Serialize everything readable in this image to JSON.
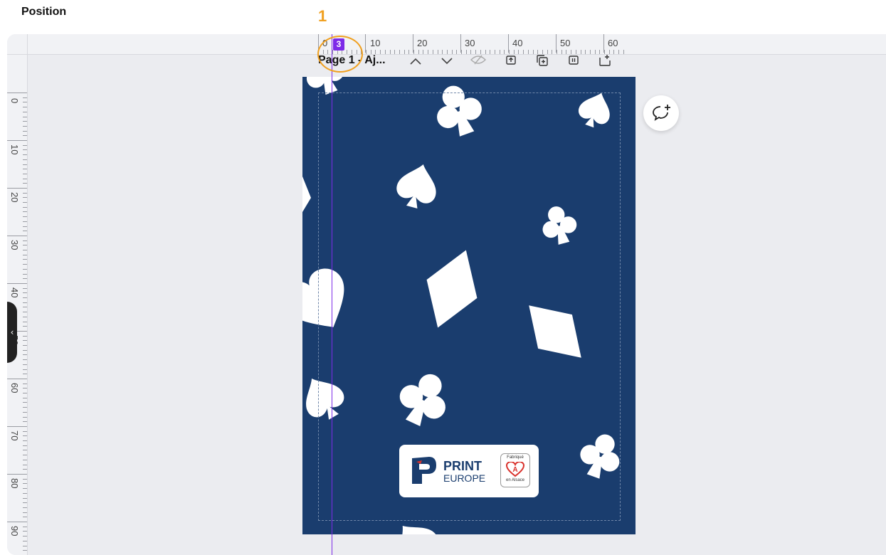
{
  "header": {
    "title": "Position",
    "annotation_number": "1"
  },
  "ruler": {
    "top_labels": [
      "0",
      "10",
      "20",
      "30",
      "40",
      "50",
      "60"
    ],
    "left_labels": [
      "0",
      "10",
      "20",
      "30",
      "40",
      "50",
      "60",
      "70",
      "80",
      "90"
    ],
    "position_badge": "3"
  },
  "page_toolbar": {
    "page_label": "Page 1 - Aj..."
  },
  "card": {
    "background": "#1a3d6e",
    "logo_brand_line1": "PRINT",
    "logo_brand_line2": "EUROPE",
    "logo_badge_top": "Fabriqué",
    "logo_badge_bottom": "en Alsace"
  },
  "colors": {
    "accent": "#7d2ae8",
    "annotation": "#f0a020"
  }
}
